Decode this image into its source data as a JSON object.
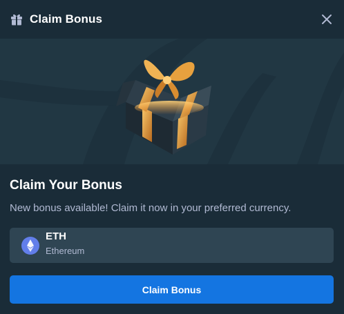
{
  "header": {
    "title": "Claim Bonus",
    "icon": "gift-icon",
    "close_icon": "close-icon"
  },
  "banner": {
    "image": "gift-box-illustration"
  },
  "main": {
    "heading": "Claim Your Bonus",
    "description": "New bonus available! Claim it now in your preferred currency."
  },
  "currency": {
    "symbol": "ETH",
    "name": "Ethereum",
    "icon": "ethereum-icon",
    "icon_color": "#627eea"
  },
  "action": {
    "claim_label": "Claim Bonus"
  },
  "colors": {
    "background": "#1a2c38",
    "banner": "#213743",
    "card": "#2f4553",
    "accent": "#1475e1",
    "muted_text": "#b1bad3"
  }
}
